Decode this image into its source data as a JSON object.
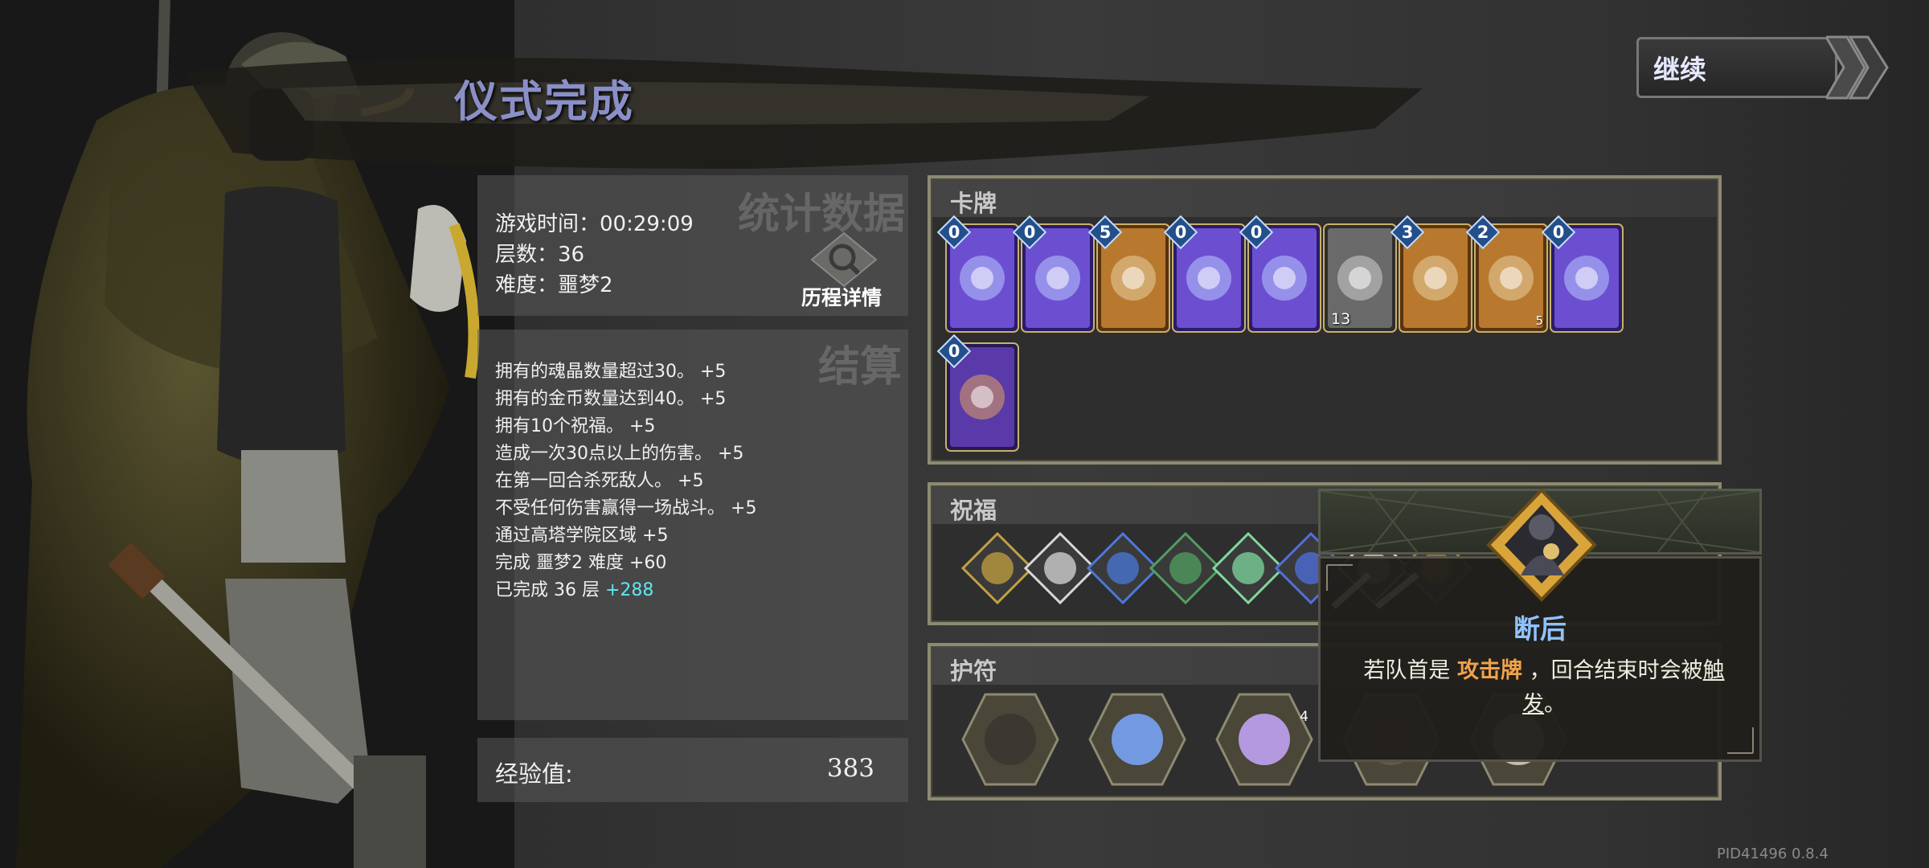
{
  "header": {
    "title": "仪式完成",
    "continue_label": "继续"
  },
  "stats": {
    "watermark": "统计数据",
    "play_time": "游戏时间：00:29:09",
    "floors": "层数：36",
    "difficulty": "难度：噩梦2",
    "history_button": "历程详情"
  },
  "settlement": {
    "watermark": "结算",
    "lines": [
      {
        "text": "拥有的魂晶数量超过30。",
        "bonus": "+5"
      },
      {
        "text": "拥有的金币数量达到40。",
        "bonus": "+5"
      },
      {
        "text": "拥有10个祝福。",
        "bonus": "+5"
      },
      {
        "text": "造成一次30点以上的伤害。",
        "bonus": "+5"
      },
      {
        "text": "在第一回合杀死敌人。",
        "bonus": "+5"
      },
      {
        "text": "不受任何伤害赢得一场战斗。",
        "bonus": "+5"
      },
      {
        "text": "通过高塔学院区域",
        "bonus": "+5"
      },
      {
        "text": "完成 噩梦2 难度",
        "bonus": "+60"
      },
      {
        "text": "已完成 36 层",
        "bonus": "+288"
      }
    ]
  },
  "experience": {
    "label": "经验值:",
    "value": "383"
  },
  "cards_section": {
    "title": "卡牌",
    "cards": [
      {
        "cost": "0",
        "icon": "hourglass-orb-card",
        "art": "purple",
        "num": ""
      },
      {
        "cost": "0",
        "icon": "knight-figure-card",
        "art": "purple",
        "num": ""
      },
      {
        "cost": "5",
        "icon": "hammer-card",
        "art": "orange",
        "num": ""
      },
      {
        "cost": "0",
        "icon": "lightning-orb-card",
        "art": "purple",
        "num": ""
      },
      {
        "cost": "0",
        "icon": "lightning-orb-card",
        "art": "purple",
        "num": ""
      },
      {
        "cost": "",
        "icon": "armor-card",
        "art": "gray",
        "num": "13"
      },
      {
        "cost": "3",
        "icon": "sword-card",
        "art": "orange",
        "num": ""
      },
      {
        "cost": "2",
        "icon": "sword-card",
        "art": "orange",
        "num": "5"
      },
      {
        "cost": "0",
        "icon": "lightning-orb-card",
        "art": "purple",
        "num": ""
      },
      {
        "cost": "0",
        "icon": "spark-orb-card",
        "art": "purple-dark",
        "num": ""
      }
    ]
  },
  "blessings_section": {
    "title": "祝福",
    "icons": [
      "claw-blessing-icon",
      "wing-blessing-icon",
      "crystal-shard-blessing-icon",
      "meditating-figure-blessing-icon",
      "green-hand-blessing-icon",
      "blue-gem-blessing-icon",
      "crossed-swords-blessing-icon",
      "cloaked-figure-blessing-icon"
    ]
  },
  "amulets_section": {
    "title": "护符",
    "amulets": [
      {
        "icon": "scroll-amulet-icon",
        "count": ""
      },
      {
        "icon": "lightning-stone-amulet-icon",
        "count": ""
      },
      {
        "icon": "crystal-mirror-amulet-icon",
        "count": "4"
      },
      {
        "icon": "beast-amulet-icon",
        "count": ""
      },
      {
        "icon": "sparkle-amulet-icon",
        "count": ""
      }
    ]
  },
  "tooltip": {
    "icon": "rearguard-blessing-icon",
    "title": "断后",
    "desc_pre": "若队首是",
    "desc_keyword": "攻击牌",
    "desc_mid": "，回合结束时会被",
    "desc_trigger": "触发",
    "desc_end": "。"
  },
  "build_info": "PID41496  0.8.4",
  "colors": {
    "title": "#8a8fc8",
    "bonus_highlight": "#5ee7f2",
    "tooltip_title": "#8fc3ff",
    "keyword": "#f0a24a",
    "frame_border": "#8c8a72"
  }
}
